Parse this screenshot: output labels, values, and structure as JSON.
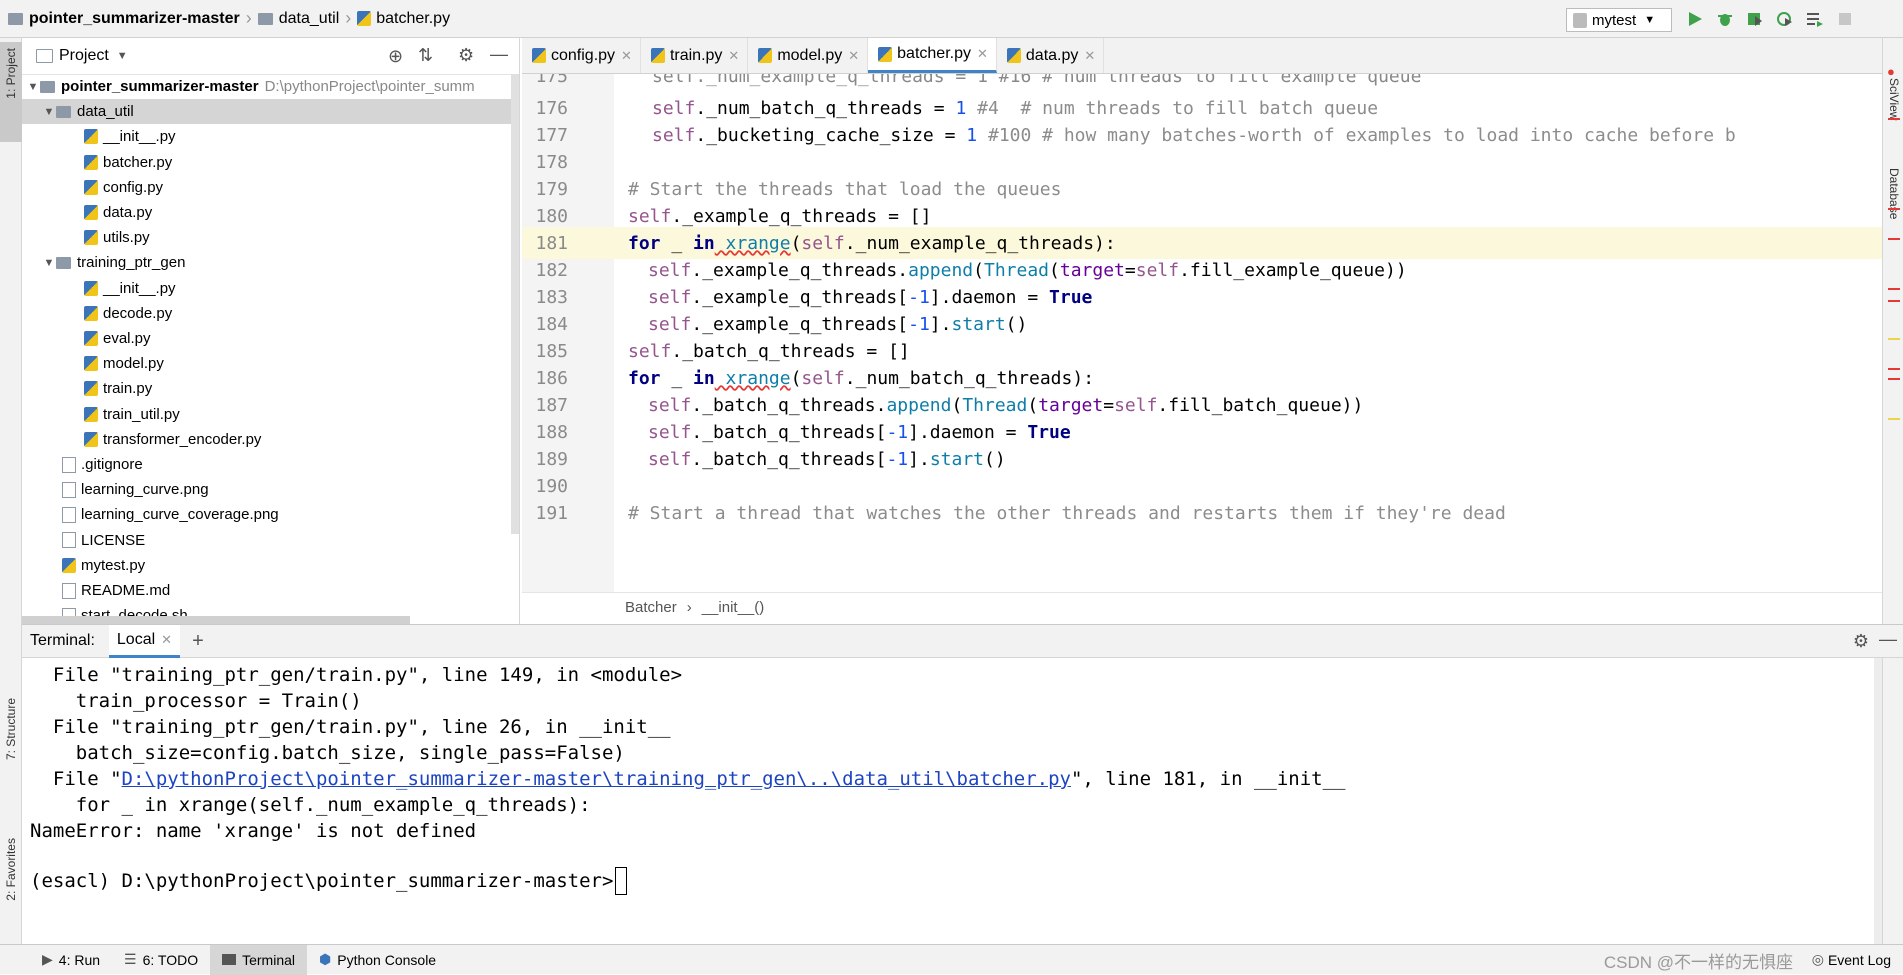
{
  "breadcrumb": {
    "project": "pointer_summarizer-master",
    "folder": "data_util",
    "file": "batcher.py"
  },
  "run_config": {
    "label": "mytest"
  },
  "left_stripe": {
    "project_tab": "1: Project",
    "structure_tab": "7: Structure",
    "favorites_tab": "2: Favorites"
  },
  "right_stripe": {
    "sciview": "SciView",
    "database": "Database"
  },
  "project_panel": {
    "title": "Project",
    "root": {
      "name": "pointer_summarizer-master",
      "path": "D:\\pythonProject\\pointer_summ"
    },
    "items": [
      {
        "name": "data_util",
        "kind": "folder",
        "level": 1,
        "expanded": true
      },
      {
        "name": "__init__.py",
        "kind": "py",
        "level": 2
      },
      {
        "name": "batcher.py",
        "kind": "py",
        "level": 2
      },
      {
        "name": "config.py",
        "kind": "py",
        "level": 2
      },
      {
        "name": "data.py",
        "kind": "py",
        "level": 2
      },
      {
        "name": "utils.py",
        "kind": "py",
        "level": 2
      },
      {
        "name": "training_ptr_gen",
        "kind": "folder",
        "level": 1,
        "expanded": true
      },
      {
        "name": "__init__.py",
        "kind": "py",
        "level": 2
      },
      {
        "name": "decode.py",
        "kind": "py",
        "level": 2
      },
      {
        "name": "eval.py",
        "kind": "py",
        "level": 2
      },
      {
        "name": "model.py",
        "kind": "py",
        "level": 2
      },
      {
        "name": "train.py",
        "kind": "py",
        "level": 2
      },
      {
        "name": "train_util.py",
        "kind": "py",
        "level": 2
      },
      {
        "name": "transformer_encoder.py",
        "kind": "py",
        "level": 2
      },
      {
        "name": ".gitignore",
        "kind": "file",
        "level": 1
      },
      {
        "name": "learning_curve.png",
        "kind": "file",
        "level": 1
      },
      {
        "name": "learning_curve_coverage.png",
        "kind": "file",
        "level": 1
      },
      {
        "name": "LICENSE",
        "kind": "file",
        "level": 1
      },
      {
        "name": "mytest.py",
        "kind": "py",
        "level": 1
      },
      {
        "name": "README.md",
        "kind": "file",
        "level": 1
      },
      {
        "name": "start_decode.sh",
        "kind": "file",
        "level": 1
      }
    ]
  },
  "editor_tabs": [
    "config.py",
    "train.py",
    "model.py",
    "batcher.py",
    "data.py"
  ],
  "active_tab": "batcher.py",
  "code_lines": {
    "n176": "176",
    "n177": "177",
    "n178": "178",
    "n179": "179",
    "n180": "180",
    "n181": "181",
    "n182": "182",
    "n183": "183",
    "n184": "184",
    "n185": "185",
    "n186": "186",
    "n187": "187",
    "n188": "188",
    "n189": "189",
    "n190": "190",
    "n191": "191"
  },
  "code_text": {
    "l176_self": "self",
    "l176_attr": "._num_batch_q_threads = ",
    "l176_num": "1",
    "l176_cmt": " #4  # num threads to fill batch queue",
    "l177_self": "self",
    "l177_attr": "._bucketing_cache_size = ",
    "l177_num": "1",
    "l177_cmt": " #100 # how many batches-worth of examples to load into cache before b",
    "l179_cmt": "# Start the threads that load the queues",
    "l180_self": "self",
    "l180_rest": "._example_q_threads = []",
    "l181_for": "for",
    "l181_a": " _ ",
    "l181_in": "in",
    "l181_fn": " xrange",
    "l181_b": "(",
    "l181_self": "self",
    "l181_c": "._num_example_q_threads):",
    "l182_self": "self",
    "l182_a": "._example_q_threads.",
    "l182_fn": "append",
    "l182_b": "(",
    "l182_thread": "Thread",
    "l182_c": "(",
    "l182_param": "target",
    "l182_d": "=",
    "l182_self2": "self",
    "l182_e": ".fill_example_queue))",
    "l183_self": "self",
    "l183_a": "._example_q_threads[",
    "l183_num": "-1",
    "l183_b": "].daemon = ",
    "l183_bool": "True",
    "l184_self": "self",
    "l184_a": "._example_q_threads[",
    "l184_num": "-1",
    "l184_b": "].",
    "l184_fn": "start",
    "l184_c": "()",
    "l185_self": "self",
    "l185_rest": "._batch_q_threads = []",
    "l186_for": "for",
    "l186_a": " _ ",
    "l186_in": "in",
    "l186_fn": " xrange",
    "l186_b": "(",
    "l186_self": "self",
    "l186_c": "._num_batch_q_threads):",
    "l187_self": "self",
    "l187_a": "._batch_q_threads.",
    "l187_fn": "append",
    "l187_b": "(",
    "l187_thread": "Thread",
    "l187_c": "(",
    "l187_param": "target",
    "l187_d": "=",
    "l187_self2": "self",
    "l187_e": ".fill_batch_queue))",
    "l188_self": "self",
    "l188_a": "._batch_q_threads[",
    "l188_num": "-1",
    "l188_b": "].daemon = ",
    "l188_bool": "True",
    "l189_self": "self",
    "l189_a": "._batch_q_threads[",
    "l189_num": "-1",
    "l189_b": "].",
    "l189_fn": "start",
    "l189_c": "()",
    "l191_cmt": "# Start a thread that watches the other threads and restarts them if they're dead"
  },
  "editor_crumb": {
    "cls": "Batcher",
    "method": "__init__()"
  },
  "terminal": {
    "label": "Terminal:",
    "tab": "Local",
    "lines": {
      "l1": "  File \"training_ptr_gen/train.py\", line 149, in <module>",
      "l2": "    train_processor = Train()",
      "l3": "  File \"training_ptr_gen/train.py\", line 26, in __init__",
      "l4": "    batch_size=config.batch_size, single_pass=False)",
      "l5_pre": "  File \"",
      "l5_link": "D:\\pythonProject\\pointer_summarizer-master\\training_ptr_gen\\..\\data_util\\batcher.py",
      "l5_post": "\", line 181, in __init__",
      "l6": "    for _ in xrange(self._num_example_q_threads):",
      "l7": "NameError: name 'xrange' is not defined",
      "l8": "(esacl) D:\\pythonProject\\pointer_summarizer-master>"
    }
  },
  "bottom_tabs": {
    "run": "4: Run",
    "todo": "6: TODO",
    "terminal": "Terminal",
    "console": "Python Console",
    "event_log": "Event Log"
  },
  "watermark": "CSDN @不一样的无惧座",
  "colors": {
    "accent": "#4083c9",
    "current_line": "#fcf8dc",
    "error_mark": "#e53935"
  }
}
